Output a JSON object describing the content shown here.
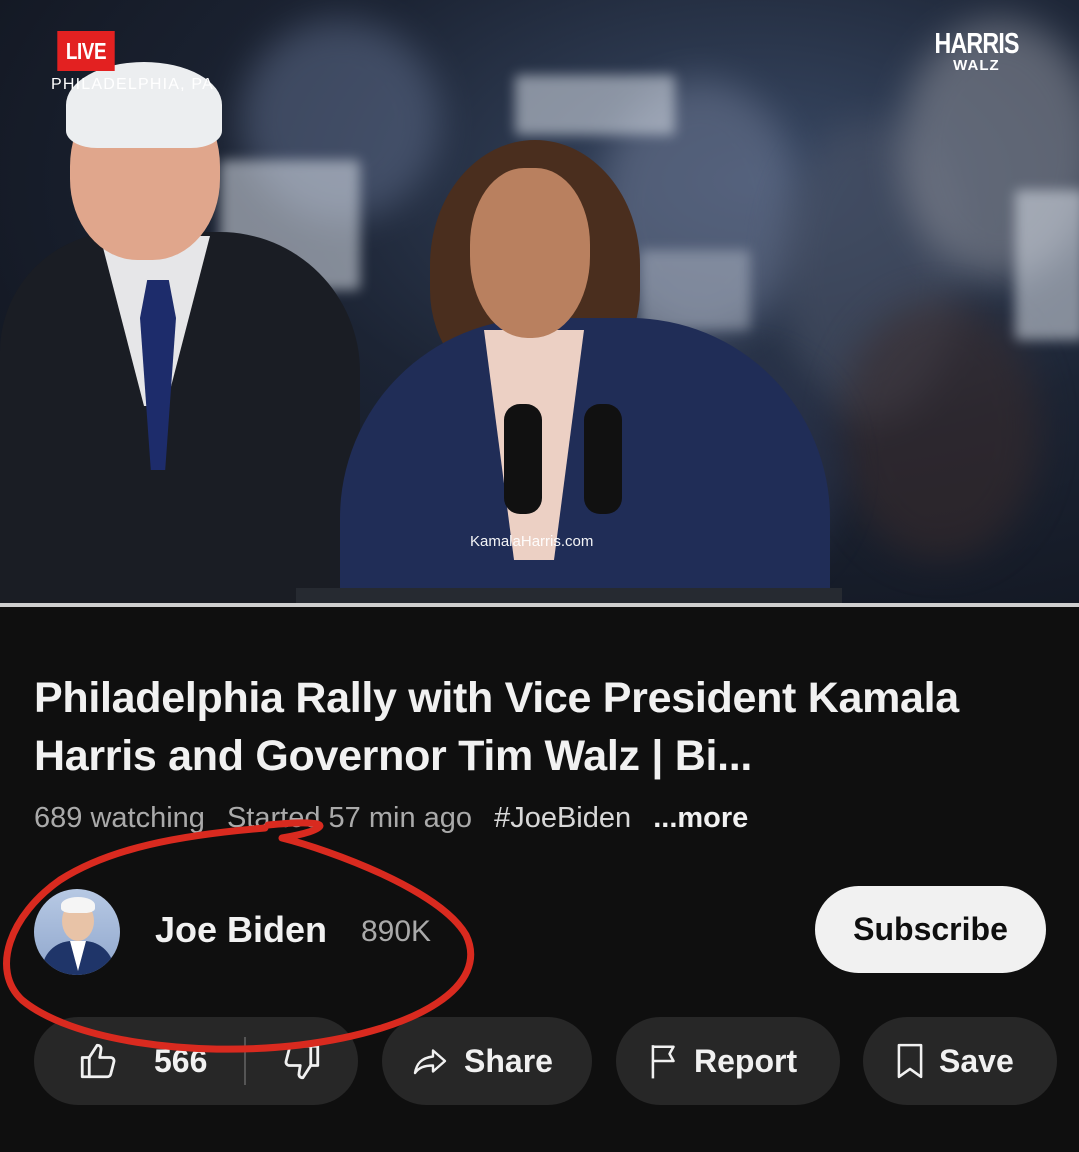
{
  "video": {
    "live_label": "LIVE",
    "location": "PHILADELPHIA, PA",
    "brand_top": "HARRIS",
    "brand_bottom": "WALZ",
    "watermark": "KamalaHarris.com"
  },
  "info": {
    "title": "Philadelphia Rally with Vice President Kamala Harris and Governor Tim Walz | Bi...",
    "watching": "689 watching",
    "started": "Started 57 min ago",
    "hashtag": "#JoeBiden",
    "more": "...more"
  },
  "channel": {
    "name": "Joe Biden",
    "subscribers": "890K",
    "subscribe_label": "Subscribe"
  },
  "actions": {
    "like_count": "566",
    "share_label": "Share",
    "report_label": "Report",
    "save_label": "Save"
  },
  "icons": {
    "like": "thumbs-up-icon",
    "dislike": "thumbs-down-icon",
    "share": "share-arrow-icon",
    "report": "flag-icon",
    "save": "bookmark-icon"
  },
  "colors": {
    "background": "#0f0f0f",
    "pill": "#272727",
    "live_red": "#e32121",
    "annotation_red": "#d92a1f",
    "subscribe_bg": "#f1f1f1"
  }
}
